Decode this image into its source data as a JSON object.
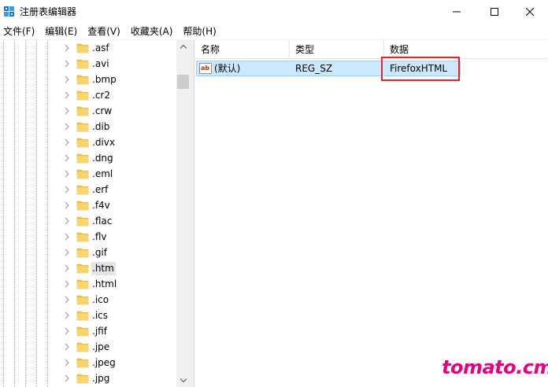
{
  "window": {
    "title": "注册表编辑器",
    "icon": "registry-editor-icon"
  },
  "menu": [
    {
      "label": "文件(F)"
    },
    {
      "label": "编辑(E)"
    },
    {
      "label": "查看(V)"
    },
    {
      "label": "收藏夹(A)"
    },
    {
      "label": "帮助(H)"
    }
  ],
  "tree": {
    "items": [
      {
        "label": ".asf"
      },
      {
        "label": ".avi"
      },
      {
        "label": ".bmp"
      },
      {
        "label": ".cr2"
      },
      {
        "label": ".crw"
      },
      {
        "label": ".dib"
      },
      {
        "label": ".divx"
      },
      {
        "label": ".dng"
      },
      {
        "label": ".eml"
      },
      {
        "label": ".erf"
      },
      {
        "label": ".f4v"
      },
      {
        "label": ".flac"
      },
      {
        "label": ".flv"
      },
      {
        "label": ".gif"
      },
      {
        "label": ".htm"
      },
      {
        "label": ".html"
      },
      {
        "label": ".ico"
      },
      {
        "label": ".ics"
      },
      {
        "label": ".jfif"
      },
      {
        "label": ".jpe"
      },
      {
        "label": ".jpeg"
      },
      {
        "label": ".jpg"
      }
    ],
    "selected_label": ".htm"
  },
  "list": {
    "columns": {
      "name": "名称",
      "type": "类型",
      "data": "数据"
    },
    "rows": [
      {
        "icon": "ab",
        "name": "(默认)",
        "type": "REG_SZ",
        "data": "FirefoxHTML"
      }
    ]
  },
  "watermark": "tomato.cm",
  "colors": {
    "selection_bg": "#cce8ff",
    "highlight_border": "#e0252b",
    "watermark": "#e4007f",
    "folder": "#f5c443"
  }
}
